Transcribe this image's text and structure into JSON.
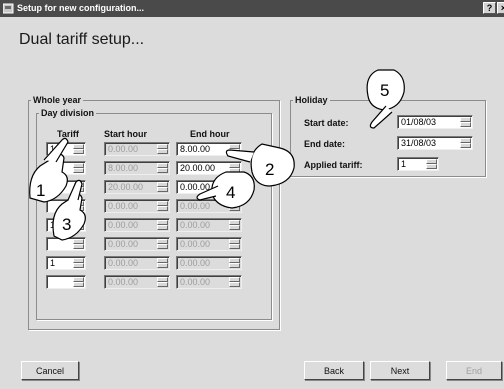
{
  "window": {
    "title": "Setup for new configuration...",
    "help_button": "?",
    "close_button": "×"
  },
  "page": {
    "heading": "Dual tariff setup..."
  },
  "whole_year": {
    "legend": "Whole year",
    "day_division": {
      "legend": "Day division",
      "headers": {
        "tariff": "Tariff",
        "start_hour": "Start hour",
        "end_hour": "End hour"
      },
      "rows": [
        {
          "tariff": "1",
          "start_hour": "0.00.00",
          "end_hour": "8.00.00"
        },
        {
          "tariff": "",
          "start_hour": "8.00.00",
          "end_hour": "20.00.00"
        },
        {
          "tariff": "",
          "start_hour": "20.00.00",
          "end_hour": "0.00.00"
        },
        {
          "tariff": "",
          "start_hour": "0.00.00",
          "end_hour": "0.00.00"
        },
        {
          "tariff": "1",
          "start_hour": "0.00.00",
          "end_hour": "0.00.00"
        },
        {
          "tariff": "",
          "start_hour": "0.00.00",
          "end_hour": "0.00.00"
        },
        {
          "tariff": "1",
          "start_hour": "0.00.00",
          "end_hour": "0.00.00"
        },
        {
          "tariff": "",
          "start_hour": "0.00.00",
          "end_hour": "0.00.00"
        }
      ]
    }
  },
  "holiday": {
    "legend": "Holiday",
    "start_date_label": "Start date:",
    "start_date": "01/08/03",
    "end_date_label": "End date:",
    "end_date": "31/08/03",
    "applied_tariff_label": "Applied tariff:",
    "applied_tariff": "1"
  },
  "buttons": {
    "cancel": "Cancel",
    "back": "Back",
    "next": "Next",
    "end": "End"
  },
  "callouts": [
    "1",
    "2",
    "3",
    "4",
    "5"
  ]
}
